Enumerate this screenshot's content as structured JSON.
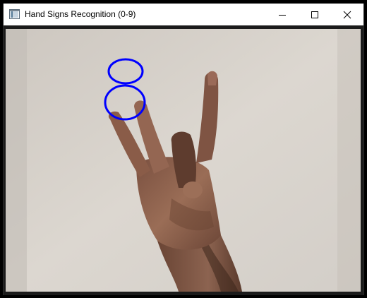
{
  "window": {
    "title": "Hand Signs Recognition (0-9)",
    "controls": [
      "minimize-icon",
      "maximize-icon",
      "close-icon"
    ]
  },
  "camera_view": {
    "overlay_digit": "8",
    "overlay_color": "#0000ff",
    "content": "webcam-frame-hand-sign"
  },
  "colors": {
    "titlebar_bg": "#ffffff",
    "frame_border": "#000000",
    "wall": "#d8d3cc",
    "skin": "#8a5f4a"
  }
}
